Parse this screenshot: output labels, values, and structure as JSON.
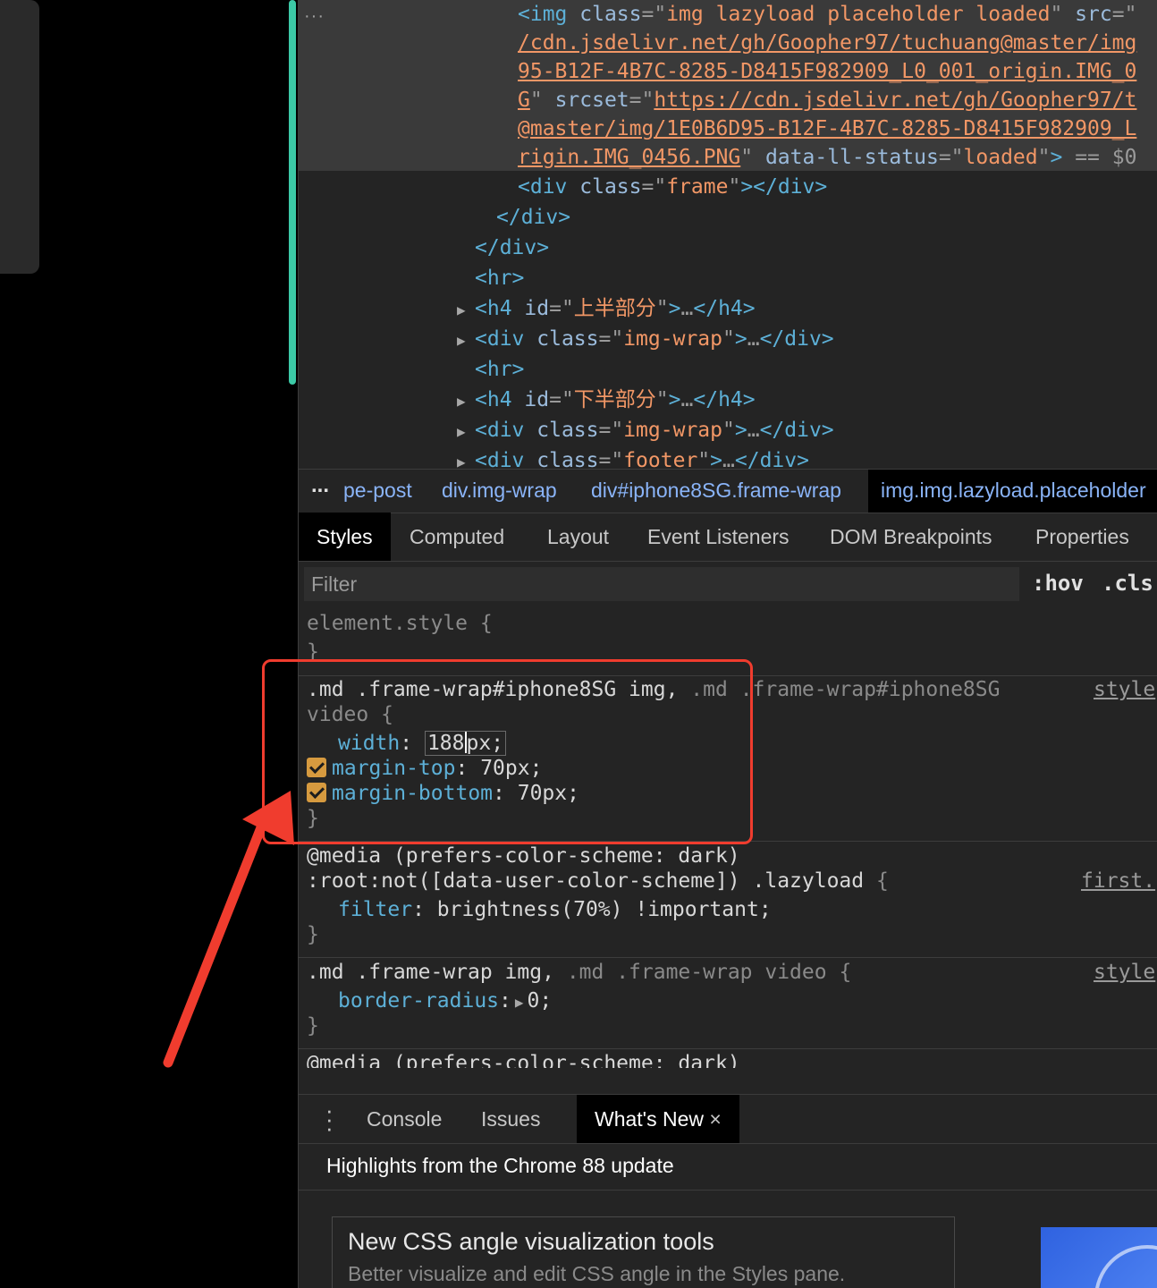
{
  "elements": {
    "dots": "···",
    "img_lines": [
      {
        "parts": [
          [
            "tag",
            "<img "
          ],
          [
            "attr",
            "class"
          ],
          [
            "eq",
            "=\""
          ],
          [
            "val",
            "img lazyload placeholder loaded"
          ],
          [
            "eq",
            "\" "
          ],
          [
            "attr",
            "src"
          ],
          [
            "eq",
            "=\""
          ]
        ]
      },
      {
        "parts": [
          [
            "link",
            "/cdn.jsdelivr.net/gh/Goopher97/tuchuang@master/img"
          ]
        ]
      },
      {
        "parts": [
          [
            "link",
            "95-B12F-4B7C-8285-D8415F982909_L0_001_origin.IMG_0"
          ]
        ]
      },
      {
        "parts": [
          [
            "link",
            "G"
          ],
          [
            "eq",
            "\" "
          ],
          [
            "attr",
            "srcset"
          ],
          [
            "eq",
            "=\""
          ],
          [
            "link",
            "https://cdn.jsdelivr.net/gh/Goopher97/t"
          ]
        ]
      },
      {
        "parts": [
          [
            "link",
            "@master/img/1E0B6D95-B12F-4B7C-8285-D8415F982909_L"
          ]
        ]
      },
      {
        "parts": [
          [
            "link",
            "rigin.IMG_0456.PNG"
          ],
          [
            "eq",
            "\" "
          ],
          [
            "attr",
            "data-ll-status"
          ],
          [
            "eq",
            "=\""
          ],
          [
            "val",
            "loaded"
          ],
          [
            "eq",
            "\""
          ],
          [
            "tag",
            ">"
          ],
          [
            "eq",
            " == $0"
          ]
        ]
      }
    ],
    "lines": [
      {
        "tri": "",
        "parts": [
          [
            "tag",
            "<div "
          ],
          [
            "attr",
            "class"
          ],
          [
            "eq",
            "=\""
          ],
          [
            "val",
            "frame"
          ],
          [
            "eq",
            "\""
          ],
          [
            "tag",
            "></div>"
          ]
        ]
      },
      {
        "tri": "",
        "parts": [
          [
            "tag",
            "</div>"
          ]
        ]
      },
      {
        "tri": "",
        "parts": [
          [
            "tag",
            "</div>"
          ]
        ]
      },
      {
        "tri": "",
        "parts": [
          [
            "tag",
            "<hr>"
          ]
        ]
      },
      {
        "tri": "▶",
        "parts": [
          [
            "tag",
            "<h4 "
          ],
          [
            "attr",
            "id"
          ],
          [
            "eq",
            "=\""
          ],
          [
            "val",
            "上半部分"
          ],
          [
            "eq",
            "\""
          ],
          [
            "tag",
            ">"
          ],
          [
            "eq",
            "…"
          ],
          [
            "tag",
            "</h4>"
          ]
        ]
      },
      {
        "tri": "▶",
        "parts": [
          [
            "tag",
            "<div "
          ],
          [
            "attr",
            "class"
          ],
          [
            "eq",
            "=\""
          ],
          [
            "val",
            "img-wrap"
          ],
          [
            "eq",
            "\""
          ],
          [
            "tag",
            ">"
          ],
          [
            "eq",
            "…"
          ],
          [
            "tag",
            "</div>"
          ]
        ]
      },
      {
        "tri": "",
        "parts": [
          [
            "tag",
            "<hr>"
          ]
        ]
      },
      {
        "tri": "▶",
        "parts": [
          [
            "tag",
            "<h4 "
          ],
          [
            "attr",
            "id"
          ],
          [
            "eq",
            "=\""
          ],
          [
            "val",
            "下半部分"
          ],
          [
            "eq",
            "\""
          ],
          [
            "tag",
            ">"
          ],
          [
            "eq",
            "…"
          ],
          [
            "tag",
            "</h4>"
          ]
        ]
      },
      {
        "tri": "▶",
        "parts": [
          [
            "tag",
            "<div "
          ],
          [
            "attr",
            "class"
          ],
          [
            "eq",
            "=\""
          ],
          [
            "val",
            "img-wrap"
          ],
          [
            "eq",
            "\""
          ],
          [
            "tag",
            ">"
          ],
          [
            "eq",
            "…"
          ],
          [
            "tag",
            "</div>"
          ]
        ]
      },
      {
        "tri": "▶",
        "parts": [
          [
            "tag",
            "<div "
          ],
          [
            "attr",
            "class"
          ],
          [
            "eq",
            "=\""
          ],
          [
            "val",
            "footer"
          ],
          [
            "eq",
            "\""
          ],
          [
            "tag",
            ">"
          ],
          [
            "eq",
            "…"
          ],
          [
            "tag",
            "</div>"
          ]
        ]
      }
    ]
  },
  "breadcrumbs": {
    "more": "...",
    "items": [
      "pe-post",
      "div.img-wrap",
      "div#iphone8SG.frame-wrap",
      "img.img.lazyload.placeholder"
    ]
  },
  "tabs": [
    "Styles",
    "Computed",
    "Layout",
    "Event Listeners",
    "DOM Breakpoints",
    "Properties"
  ],
  "filter": {
    "placeholder": "Filter",
    "hov": ":hov",
    "cls": ".cls"
  },
  "styles": {
    "element_style": "element.style {",
    "close": "}",
    "rule1": {
      "sel_a": ".md .frame-wrap#iphone8SG img,",
      "sel_b": ".md",
      "sel_c": ".frame-wrap#iphone8SG",
      "sel_d": "video {",
      "source": "style",
      "width_prop": "width",
      "width_num": "188",
      "width_unit": "px;",
      "mt_prop": "margin-top",
      "mt_val": "70px;",
      "mb_prop": "margin-bottom",
      "mb_val": "70px;"
    },
    "rule2": {
      "media": "@media (prefers-color-scheme: dark)",
      "sel": ":root:not([data-user-color-scheme]) .lazyload",
      "brace": "{",
      "source": "first.",
      "prop": "filter",
      "val": "brightness(70%) !important;"
    },
    "rule3": {
      "sel_a": ".md .frame-wrap img,",
      "sel_b": ".md .frame-wrap video",
      "brace": "{",
      "source": "style",
      "prop": "border-radius",
      "val": "0;"
    },
    "rule4": {
      "media": "@media (prefers-color-scheme: dark)"
    }
  },
  "drawer": {
    "tabs": [
      "Console",
      "Issues",
      "What's New"
    ],
    "close": "×",
    "highlights": "Highlights from the Chrome 88 update",
    "card_title": "New CSS angle visualization tools",
    "card_desc": "Better visualize and edit CSS angle in the Styles pane."
  },
  "colors": {
    "accent_teal": "#3cc9a6",
    "annotation_red": "#f03c2e",
    "checkbox": "#d69a3f"
  }
}
